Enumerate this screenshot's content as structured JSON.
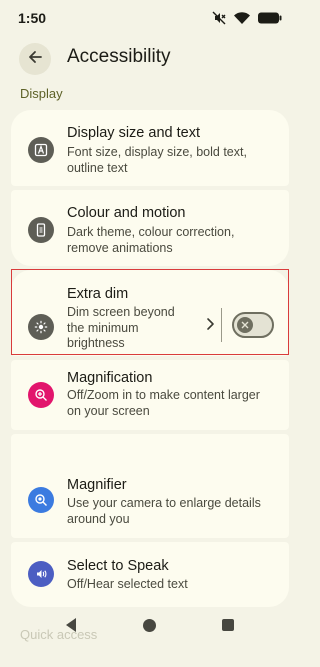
{
  "status": {
    "time": "1:50",
    "icons": [
      "mute-icon",
      "wifi-icon",
      "battery-icon"
    ]
  },
  "header": {
    "title": "Accessibility",
    "back_icon": "arrow-left-icon"
  },
  "section": {
    "label": "Display"
  },
  "items": [
    {
      "title": "Display size and text",
      "subtitle": "Font size, display size, bold text, outline text",
      "icon": "text-size-icon",
      "icon_color": "#5e5e56"
    },
    {
      "title": "Colour and motion",
      "subtitle": "Dark theme, colour correction, remove animations",
      "icon": "phone-color-icon",
      "icon_color": "#5e5e56"
    },
    {
      "title": "Extra dim",
      "subtitle": "Dim screen beyond the minimum brightness",
      "icon": "dim-sun-icon",
      "icon_color": "#5e5e56",
      "toggle_on": false
    },
    {
      "title": "Magnification",
      "subtitle": "Off/Zoom in to make content larger on your screen",
      "icon": "zoom-plus-icon",
      "icon_color": "#e2156c"
    },
    {
      "title": "Magnifier",
      "subtitle": "Use your camera to enlarge details around you",
      "icon": "magnifier-icon",
      "icon_color": "#3b7be0"
    },
    {
      "title": "Select to Speak",
      "subtitle": "Off/Hear selected text",
      "icon": "speak-icon",
      "icon_color": "#4c5ec2"
    }
  ],
  "footer": {
    "partial_label": "Quick access"
  },
  "colors": {
    "background": "#f4f3e6",
    "card": "#fdfcef",
    "accent": "#5d6127",
    "highlight": "#d93b3b"
  }
}
